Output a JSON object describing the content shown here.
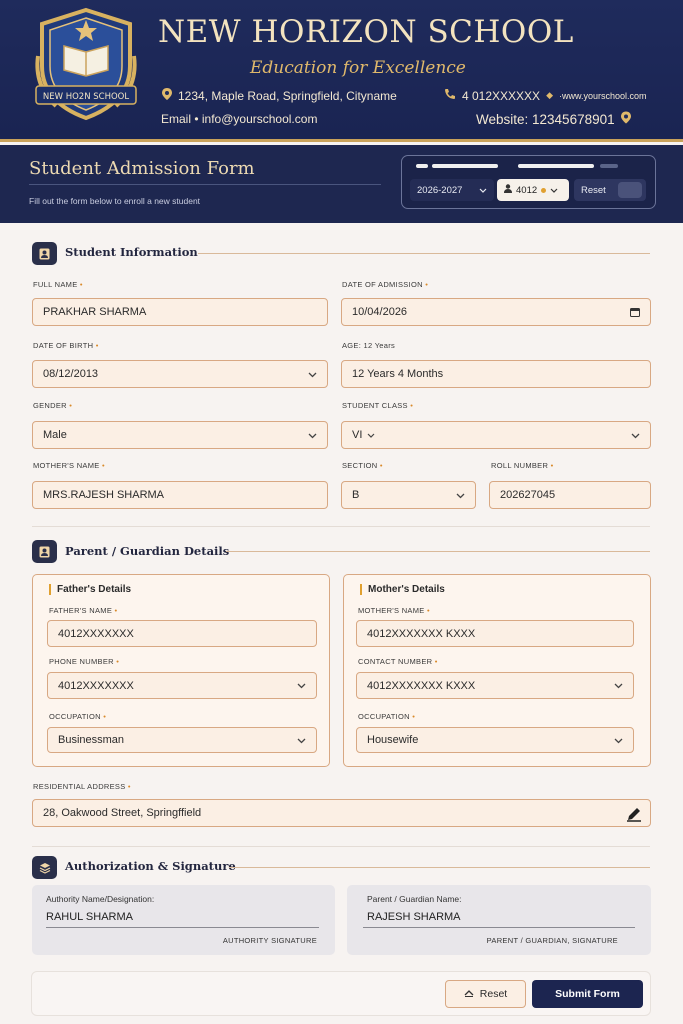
{
  "header": {
    "logo_text": "NEW HO2N SCHOOL",
    "school_name": "NEW HORIZON SCHOOL",
    "tagline": "Education for Excellence",
    "address": "1234, Maple Road, Springfield, Cityname",
    "phone": "4 012XXXXXX",
    "web_small": "·www.yourschool.com",
    "email": "Email • info@yourschool.com",
    "website": "Website: 12345678901"
  },
  "subheader": {
    "title": "Student Admission Form",
    "subtitle": "Fill out the form below to enroll a new student",
    "session": "2026-2027",
    "user_id": "4012",
    "reset_label": "Reset"
  },
  "student": {
    "section_title": "Student Information",
    "full_name_label": "FULL NAME",
    "full_name": "PRAKHAR SHARMA",
    "admission_label": "DATE OF ADMISSION",
    "admission_date": "10/04/2026",
    "dob_label": "DATE OF BIRTH",
    "dob": "08/12/2013",
    "age_label": "AGE: 12 Years",
    "age": "12 Years 4 Months",
    "gender_label": "GENDER",
    "gender": "Male",
    "class_label": "STUDENT CLASS",
    "class": "VI",
    "mother_label": "MOTHER'S NAME",
    "mother_name": "MRS.RAJESH SHARMA",
    "section_label": "SECTION",
    "section": "B",
    "roll_label": "ROLL NUMBER",
    "roll": "202627045"
  },
  "parent": {
    "section_title": "Parent / Guardian Details",
    "father": {
      "title": "Father's Details",
      "name_label": "FATHER'S NAME",
      "name": "4012XXXXXXX",
      "phone_label": "PHONE NUMBER",
      "phone": "4012XXXXXXX",
      "occupation_label": "OCCUPATION",
      "occupation": "Businessman"
    },
    "mother": {
      "title": "Mother's Details",
      "name_label": "MOTHER'S NAME",
      "name": "4012XXXXXXX KXXX",
      "contact_label": "CONTACT NUMBER",
      "contact": "4012XXXXXXX KXXX",
      "occupation_label": "OCCUPATION",
      "occupation": "Housewife"
    },
    "address_label": "RESIDENTIAL ADDRESS",
    "address": "28, Oakwood Street, Springffield"
  },
  "auth": {
    "section_title": "Authorization & Signature",
    "authority_label": "Authority Name/Designation:",
    "authority_name": "RAHUL SHARMA",
    "authority_caption": "AUTHORITY SIGNATURE",
    "guardian_label": "Parent /  Guardian Name:",
    "guardian_name": "RAJESH SHARMA",
    "guardian_caption": "PARENT / GUARDIAN, SIGNATURE"
  },
  "footer": {
    "reset_label": "Reset",
    "submit_label": "Submit Form"
  },
  "colors": {
    "navy": "#1f2b5c",
    "gold": "#e0b96b",
    "field_bg": "#fbefe4",
    "field_border": "#d8a883"
  }
}
